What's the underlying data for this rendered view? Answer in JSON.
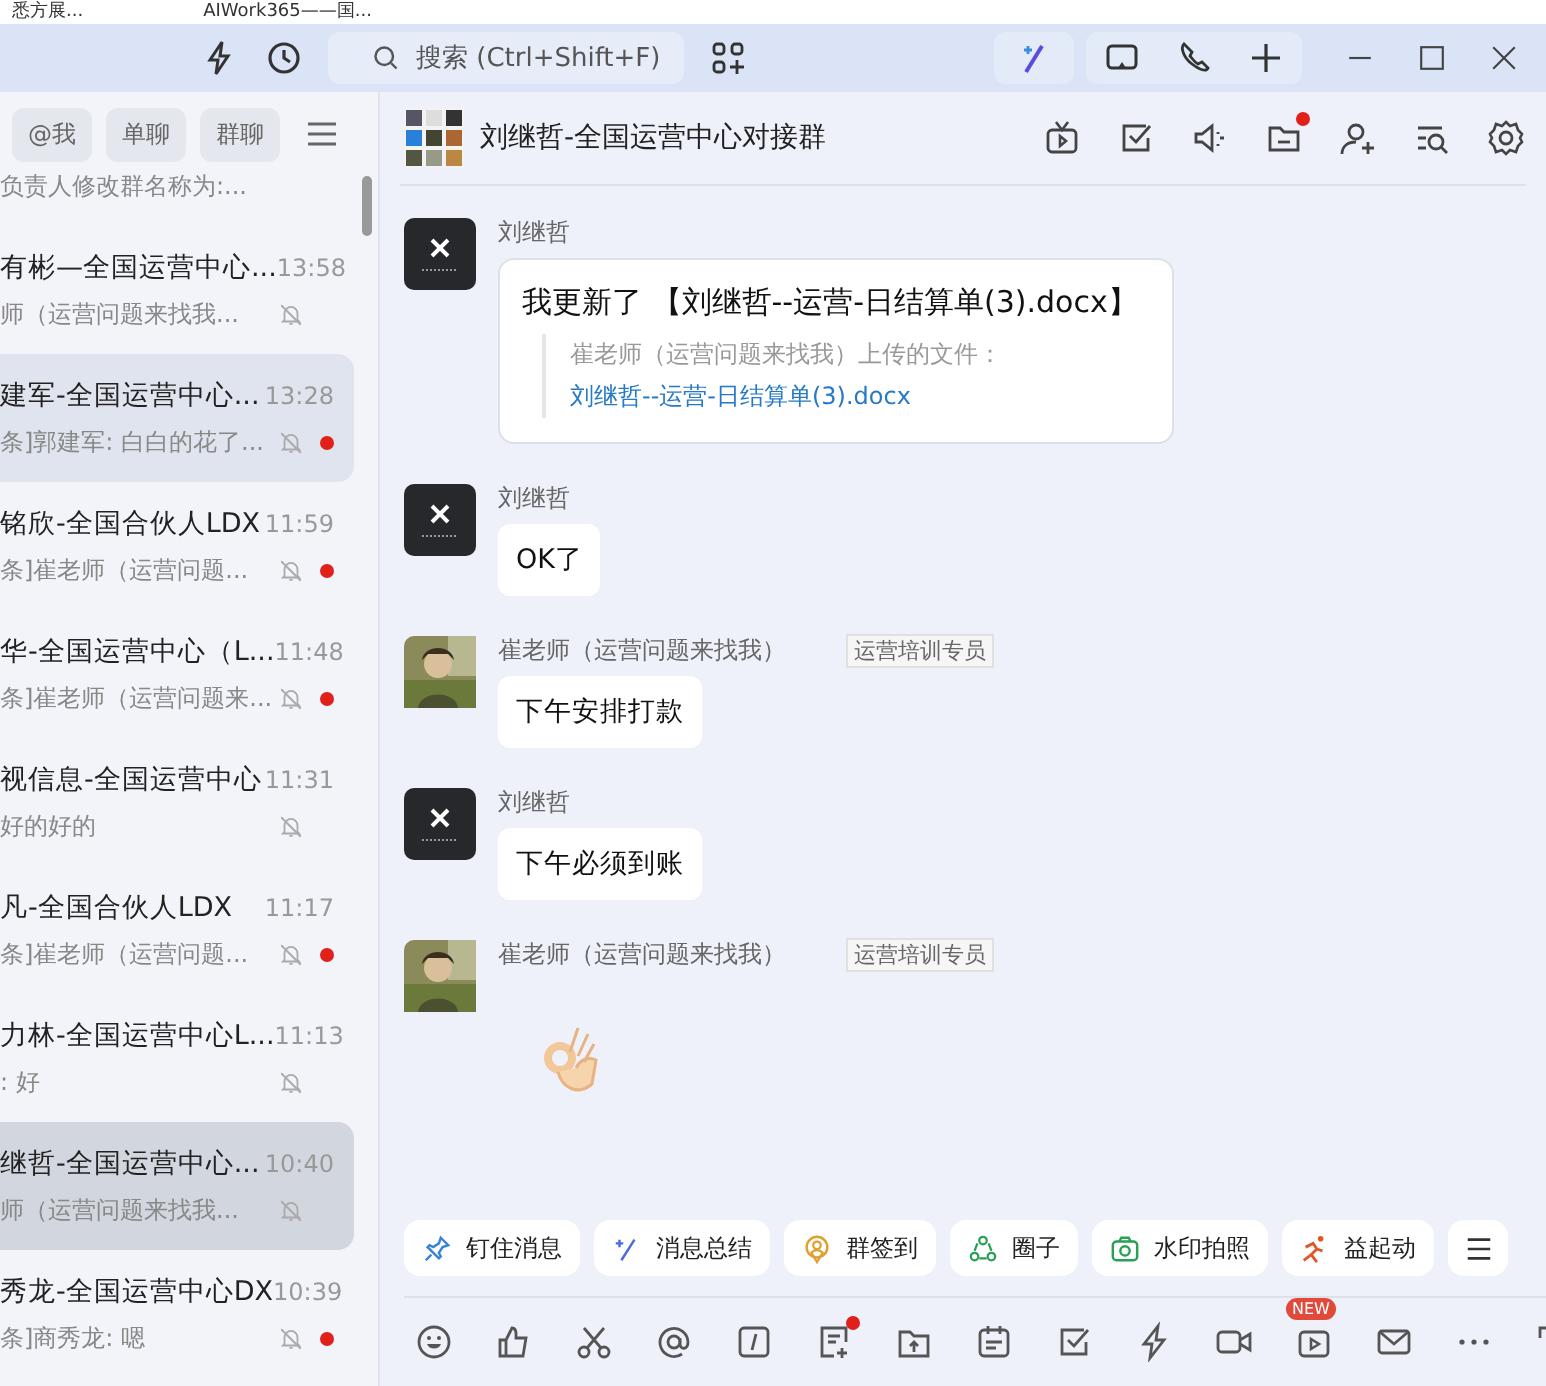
{
  "browser_tabs": [
    {
      "title": "悉方展..."
    },
    {
      "title": "AIWork365——国..."
    }
  ],
  "title_bar": {
    "search": {
      "placeholder": "搜索 (Ctrl+Shift+F)"
    }
  },
  "filters": [
    {
      "label": "@我",
      "selected": false
    },
    {
      "label": "单聊",
      "selected": false
    },
    {
      "label": "群聊",
      "selected": false
    }
  ],
  "list_top_preview": "负责人修改群名称为:...",
  "conversations": [
    {
      "name": "有彬—全国运营中心...",
      "time": "13:58",
      "preview": "师（运营问题来找我...",
      "muted": true,
      "unread": false,
      "selected": false,
      "hovered": false
    },
    {
      "name": "建军-全国运营中心...",
      "time": "13:28",
      "preview": "条]郭建军: 白白的花了...",
      "muted": true,
      "unread": true,
      "selected": false,
      "hovered": true
    },
    {
      "name": "铭欣-全国合伙人LDX",
      "time": "11:59",
      "preview": "条]崔老师（运营问题...",
      "muted": true,
      "unread": true,
      "selected": false,
      "hovered": false
    },
    {
      "name": "华-全国运营中心（L...",
      "time": "11:48",
      "preview": "条]崔老师（运营问题来...",
      "muted": true,
      "unread": true,
      "selected": false,
      "hovered": false
    },
    {
      "name": "视信息-全国运营中心",
      "time": "11:31",
      "preview": "好的好的",
      "muted": true,
      "unread": false,
      "selected": false,
      "hovered": false
    },
    {
      "name": "凡-全国合伙人LDX",
      "time": "11:17",
      "preview": "条]崔老师（运营问题...",
      "muted": true,
      "unread": true,
      "selected": false,
      "hovered": false
    },
    {
      "name": "力林-全国运营中心L...",
      "time": "11:13",
      "preview": ": 好",
      "muted": true,
      "unread": false,
      "selected": false,
      "hovered": false
    },
    {
      "name": "继哲-全国运营中心...",
      "time": "10:40",
      "preview": "师（运营问题来找我...",
      "muted": true,
      "unread": false,
      "selected": true,
      "hovered": false
    },
    {
      "name": "秀龙-全国运营中心DX",
      "time": "10:39",
      "preview": "条]商秀龙: 嗯",
      "muted": true,
      "unread": true,
      "selected": false,
      "hovered": false
    }
  ],
  "chat": {
    "title": "刘继哲-全国运营中心对接群",
    "header_tools": [
      {
        "dot": false
      },
      {
        "dot": false
      },
      {
        "dot": false
      },
      {
        "dot": true
      },
      {
        "dot": false
      },
      {
        "dot": false
      },
      {
        "dot": false
      }
    ],
    "messages": [
      {
        "sender": "刘继哲",
        "avatar": {
          "kind": "logo"
        },
        "kind": "file_update",
        "text": "我更新了 【刘继哲--运营-日结算单(3).docx】",
        "quote": "崔老师（运营问题来找我）上传的文件：",
        "file_link": "刘继哲--运营-日结算单(3).docx"
      },
      {
        "sender": "刘继哲",
        "avatar": {
          "kind": "logo"
        },
        "kind": "text",
        "text": "OK了"
      },
      {
        "sender": "崔老师（运营问题来找我）",
        "tag": "运营培训专员",
        "kind": "text",
        "text": "下午安排打款"
      },
      {
        "sender": "刘继哲",
        "avatar": {
          "kind": "logo"
        },
        "kind": "text",
        "text": "下午必须到账"
      },
      {
        "sender": "崔老师（运营问题来找我）",
        "tag": "运营培训专员",
        "kind": "sticker"
      }
    ]
  },
  "quick_actions": [
    {
      "label": "钉住消息"
    },
    {
      "label": "消息总结"
    },
    {
      "label": "群签到"
    },
    {
      "label": "圈子"
    },
    {
      "label": "水印拍照"
    },
    {
      "label": "益起动"
    }
  ],
  "composer_tools": [
    {
      "dot": false
    },
    {
      "dot": false
    },
    {
      "dot": false
    },
    {
      "dot": false
    },
    {
      "dot": false
    },
    {
      "dot": true
    },
    {
      "dot": false
    },
    {
      "dot": false
    },
    {
      "dot": false
    },
    {
      "dot": false
    },
    {
      "dot": false
    },
    {
      "badge": "NEW",
      "dot": false
    },
    {
      "dot": false
    },
    {
      "dot": false
    },
    {
      "dot": false
    }
  ]
}
